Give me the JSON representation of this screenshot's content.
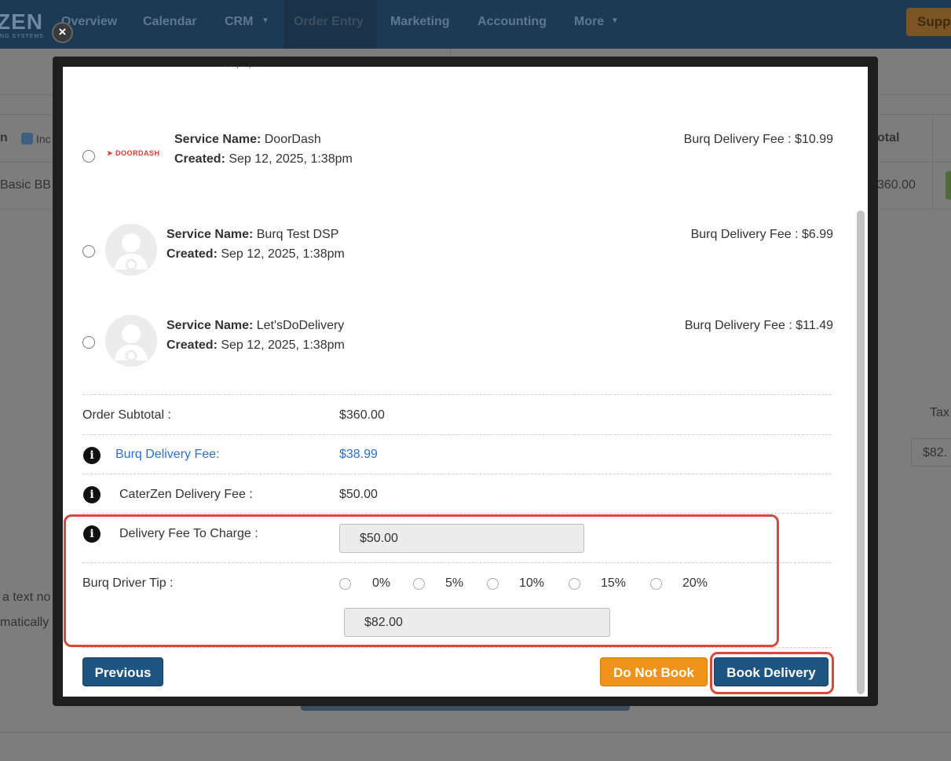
{
  "app": {
    "logo_text": "ZEN",
    "logo_sub": "NG SYSTEMS",
    "nav": [
      "Overview",
      "Calendar",
      "CRM",
      "Order Entry",
      "Marketing",
      "Accounting",
      "More"
    ],
    "support_label": "Supp"
  },
  "background": {
    "checkbox_label": "Inc",
    "col_total": "otal",
    "item_name": "Basic BB",
    "item_total": "360.00",
    "tax_label": "Tax",
    "tax_value": "$82.",
    "note1": "a text no",
    "note2": "matically"
  },
  "modal": {
    "close_label": "×",
    "services": [
      {
        "logo": "DOORDASH",
        "name_label": "Service Name:",
        "name": "DoorDash",
        "created_label": "Created:",
        "created": "Sep 12, 2025, 1:38pm",
        "fee": "Burq Delivery Fee : $10.99"
      },
      {
        "name_label": "Service Name:",
        "name": "Burq Test DSP",
        "created_label": "Created:",
        "created": "Sep 12, 2025, 1:38pm",
        "fee": "Burq Delivery Fee : $6.99"
      },
      {
        "name_label": "Service Name:",
        "name": "Let'sDoDelivery",
        "created_label": "Created:",
        "created": "Sep 12, 2025, 1:38pm",
        "fee": "Burq Delivery Fee : $11.49"
      }
    ],
    "summary": {
      "subtotal_label": "Order Subtotal :",
      "subtotal": "$360.00",
      "burq_fee_label": "Burq Delivery Fee:",
      "burq_fee": "$38.99",
      "caterzen_fee_label": "CaterZen Delivery Fee :",
      "caterzen_fee": "$50.00",
      "charge_label": "Delivery Fee To Charge :",
      "charge_value": "$50.00",
      "tip_label": "Burq Driver Tip :",
      "tip_options": [
        "0%",
        "5%",
        "10%",
        "15%",
        "20%"
      ],
      "tip_value": "$82.00"
    },
    "buttons": {
      "previous": "Previous",
      "do_not_book": "Do Not Book",
      "book_delivery": "Book Delivery"
    }
  }
}
